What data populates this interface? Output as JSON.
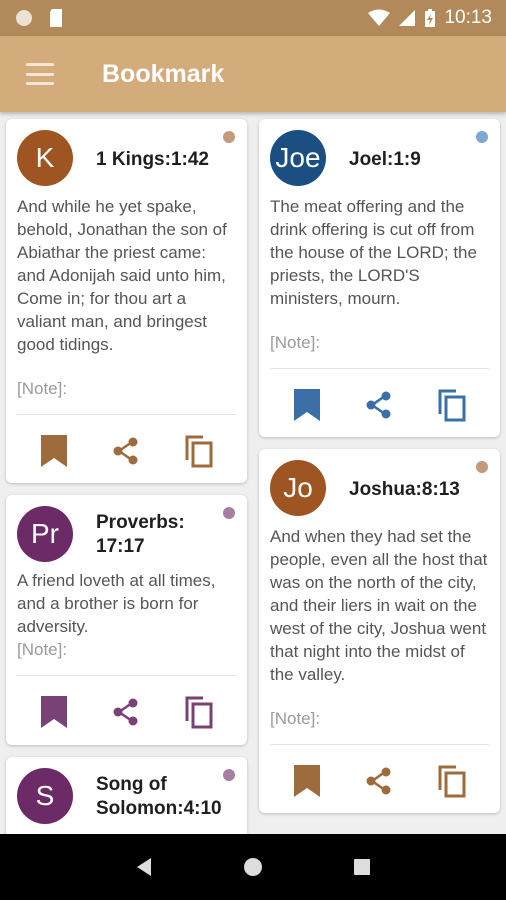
{
  "status_bar": {
    "time": "10:13"
  },
  "app_bar": {
    "title": "Bookmark"
  },
  "cards": [
    {
      "avatar": "K",
      "avatar_color": "#9e5521",
      "reference": "1 Kings:1:42",
      "dot_color": "#c39b7a",
      "accent": "#9e6b3c",
      "text": "And while he yet spake, behold, Jonathan the son of Abiathar the priest came: and Adonijah said unto him, Come in; for thou art a valiant man, and bringest good tidings.",
      "note": "[Note]:"
    },
    {
      "avatar": "Joe",
      "avatar_color": "#1b4f82",
      "reference": "Joel:1:9",
      "dot_color": "#7ea7d2",
      "accent": "#3a6fa8",
      "text": "The meat offering and the drink offering is cut off from the house of the LORD; the priests, the LORD'S ministers, mourn.",
      "note": "[Note]:"
    },
    {
      "avatar": "Pr",
      "avatar_color": "#6c2a66",
      "reference": "Proverbs: 17:17",
      "dot_color": "#a77fa2",
      "accent": "#7a4274",
      "text": "A friend loveth at all times, and a brother is born for adversity.",
      "note": "[Note]:"
    },
    {
      "avatar": "Jo",
      "avatar_color": "#9e5521",
      "reference": "Joshua:8:13",
      "dot_color": "#c39b7a",
      "accent": "#9e6b3c",
      "text": "And when they had set the people, even all the host that was on the north of the city, and their liers in wait on the west of the city, Joshua went that night into the midst of the valley.",
      "note": "[Note]:"
    },
    {
      "avatar": "S",
      "avatar_color": "#6c2a66",
      "reference": "Song of Solomon:4:10",
      "dot_color": "#a77fa2",
      "accent": "#7a4274",
      "text": "",
      "note": ""
    }
  ]
}
